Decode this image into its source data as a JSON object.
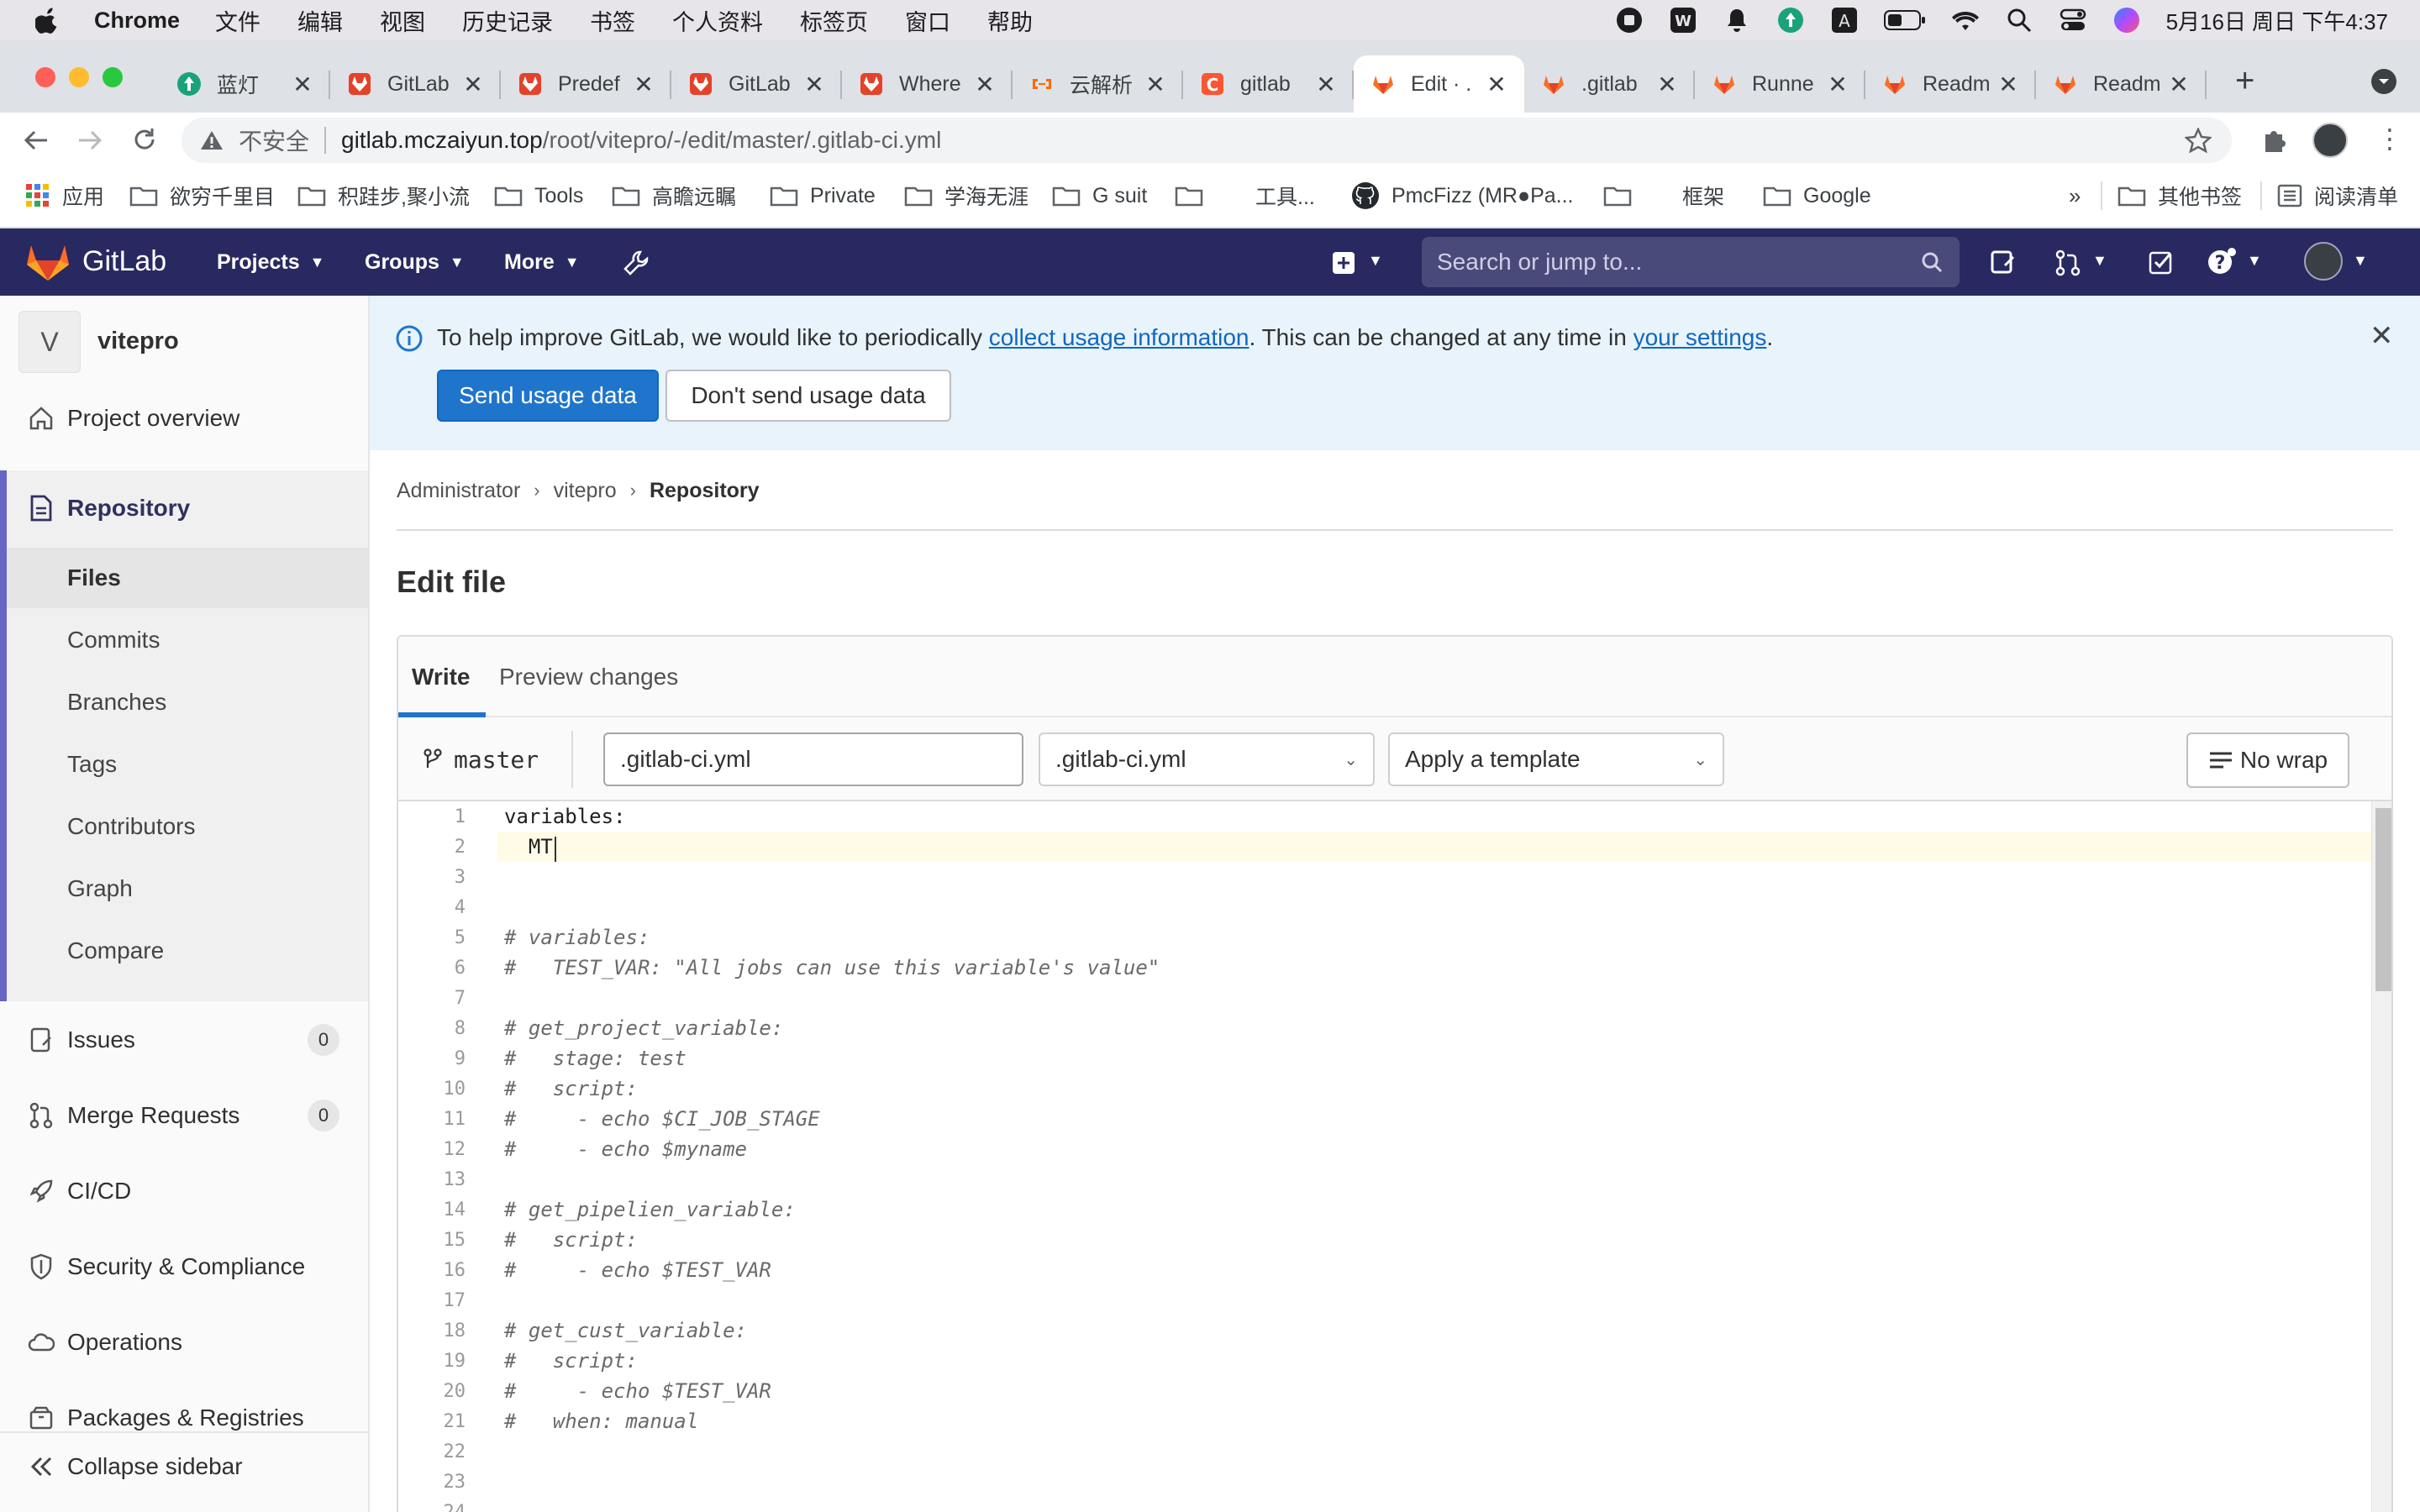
{
  "menubar": {
    "items": [
      "Chrome",
      "文件",
      "编辑",
      "视图",
      "历史记录",
      "书签",
      "个人资料",
      "标签页",
      "窗口",
      "帮助"
    ],
    "clock": "5月16日 周日 下午4:37"
  },
  "browser": {
    "tabs": [
      {
        "title": "蓝灯",
        "icon": "lantern-icon"
      },
      {
        "title": "GitLab",
        "icon": "gitlab-icon"
      },
      {
        "title": "Predef",
        "icon": "gitlab-icon"
      },
      {
        "title": "GitLab",
        "icon": "gitlab-icon"
      },
      {
        "title": "Where",
        "icon": "gitlab-icon"
      },
      {
        "title": "云解析",
        "icon": "cloud-icon"
      },
      {
        "title": "gitlab",
        "icon": "csdn-icon"
      },
      {
        "title": "Edit · .",
        "icon": "gitlab-icon"
      },
      {
        "title": ".gitlab",
        "icon": "gitlab-icon"
      },
      {
        "title": "Runne",
        "icon": "gitlab-icon"
      },
      {
        "title": "Readm",
        "icon": "gitlab-icon"
      },
      {
        "title": "Readm",
        "icon": "gitlab-icon"
      }
    ],
    "address": {
      "insecure_label": "不安全",
      "host": "gitlab.mczaiyun.top",
      "path": "/root/vitepro/-/edit/master/.gitlab-ci.yml"
    },
    "bookmarks": {
      "apps": "应用",
      "items": [
        "欲穷千里目",
        "积跬步,聚小流",
        "Tools",
        "高瞻远瞩",
        "Private",
        "学海无涯",
        "G suit",
        "工具...",
        "PmcFizz (MR●Pa...",
        "框架",
        "Google"
      ],
      "more": "»",
      "other": "其他书签",
      "reading_list": "阅读清单"
    }
  },
  "gitlab_header": {
    "brand": "GitLab",
    "nav": [
      "Projects",
      "Groups",
      "More"
    ],
    "search_placeholder": "Search or jump to..."
  },
  "sidebar": {
    "project_initial": "V",
    "project_name": "vitepro",
    "items": [
      {
        "label": "Project overview"
      },
      {
        "label": "Repository"
      },
      {
        "label": "Issues",
        "count": "0"
      },
      {
        "label": "Merge Requests",
        "count": "0"
      },
      {
        "label": "CI/CD"
      },
      {
        "label": "Security & Compliance"
      },
      {
        "label": "Operations"
      },
      {
        "label": "Packages & Registries"
      }
    ],
    "repository_sub": [
      "Files",
      "Commits",
      "Branches",
      "Tags",
      "Contributors",
      "Graph",
      "Compare"
    ],
    "collapse_label": "Collapse sidebar"
  },
  "banner": {
    "text_before": "To help improve GitLab, we would like to periodically ",
    "link1": "collect usage information",
    "text_middle": ". This can be changed at any time in ",
    "link2": "your settings",
    "text_after": ".",
    "send_button": "Send usage data",
    "dont_send_button": "Don't send usage data"
  },
  "breadcrumb": [
    "Administrator",
    "vitepro",
    "Repository"
  ],
  "page_title": "Edit file",
  "editor": {
    "tabs": [
      "Write",
      "Preview changes"
    ],
    "branch": "master",
    "filename_value": ".gitlab-ci.yml",
    "filetype_select": ".gitlab-ci.yml",
    "template_select": "Apply a template",
    "nowrap_button": "No wrap",
    "lines": [
      "variables:",
      "  MT",
      "",
      "",
      "# variables:",
      "#   TEST_VAR: \"All jobs can use this variable's value\"",
      "",
      "# get_project_variable:",
      "#   stage: test",
      "#   script:",
      "#     - echo $CI_JOB_STAGE",
      "#     - echo $myname",
      "",
      "# get_pipelien_variable:",
      "#   script:",
      "#     - echo $TEST_VAR",
      "",
      "# get_cust_variable:",
      "#   script:",
      "#     - echo $TEST_VAR",
      "#   when: manual",
      "",
      "",
      ""
    ]
  },
  "colors": {
    "gitlab_header_bg": "#292961",
    "accent_blue": "#1f75cb",
    "sidebar_active_bar": "#6666c4",
    "link_blue": "#1068bf",
    "banner_bg": "#e8f3fc"
  }
}
